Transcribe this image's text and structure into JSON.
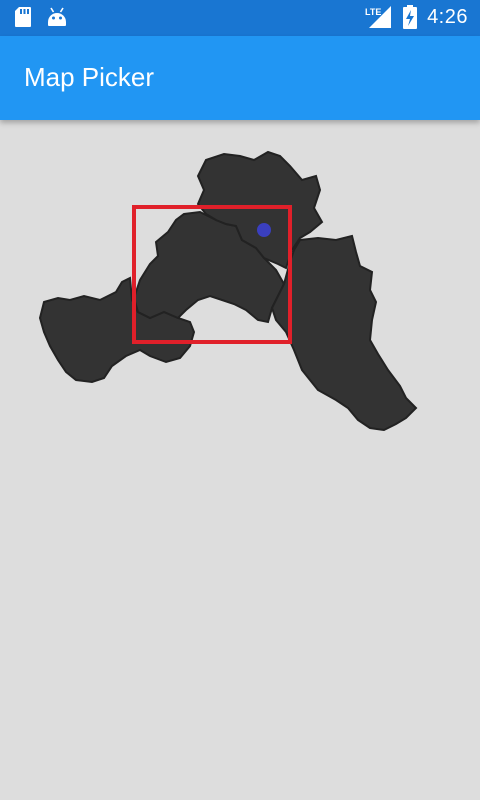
{
  "status_bar": {
    "time": "4:26",
    "network_label": "LTE",
    "background_color": "#1976d2",
    "left_icons": [
      "sd-card-icon",
      "android-icon"
    ],
    "right_icons": [
      "lte-signal-icon",
      "battery-charging-icon"
    ]
  },
  "app_bar": {
    "title": "Map Picker",
    "background_color": "#2196f3"
  },
  "map": {
    "region_color": "#333333",
    "border_color": "#222222",
    "selection_box_color": "#e0202a",
    "marker_color": "#3a3fbf",
    "background_color": "#dddddd"
  }
}
